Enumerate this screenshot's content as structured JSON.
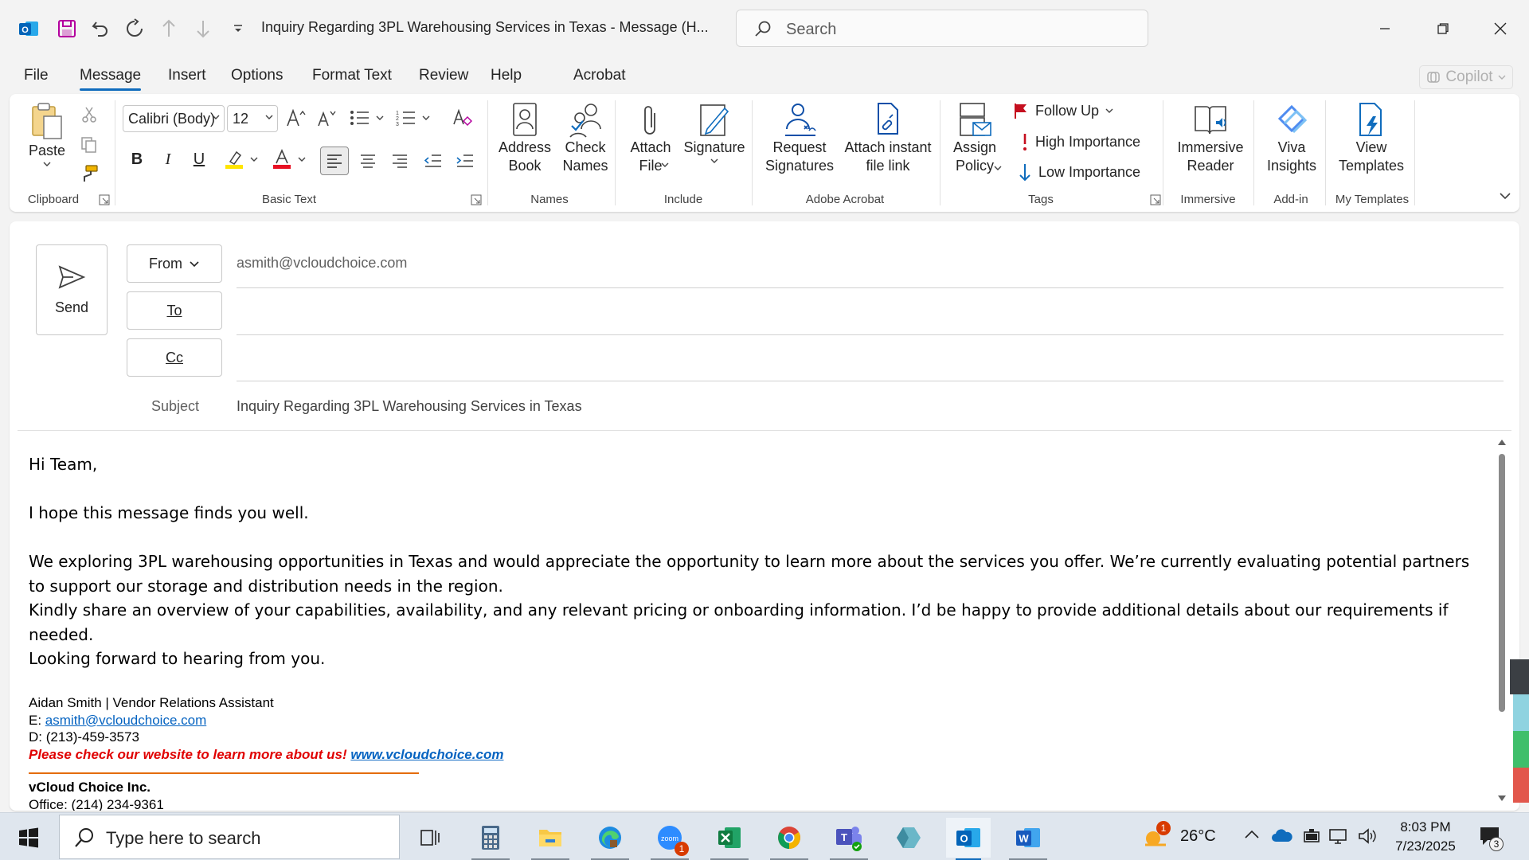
{
  "window": {
    "title": "Inquiry Regarding 3PL Warehousing Services in Texas  -  Message (H...",
    "search_placeholder": "Search"
  },
  "tabs": [
    {
      "label": "File"
    },
    {
      "label": "Message"
    },
    {
      "label": "Insert"
    },
    {
      "label": "Options"
    },
    {
      "label": "Format Text"
    },
    {
      "label": "Review"
    },
    {
      "label": "Help"
    },
    {
      "label": "Acrobat"
    }
  ],
  "active_tab": "Message",
  "copilot_label": "Copilot",
  "ribbon": {
    "clipboard": {
      "group": "Clipboard",
      "paste": "Paste"
    },
    "basic_text": {
      "group": "Basic Text",
      "font": "Calibri (Body)",
      "size": "12"
    },
    "names": {
      "group": "Names",
      "address_book": "Address\nBook",
      "check_names": "Check\nNames"
    },
    "include": {
      "group": "Include",
      "attach_file": "Attach\nFile",
      "signature": "Signature"
    },
    "acrobat": {
      "group": "Adobe Acrobat",
      "request_signatures": "Request\nSignatures",
      "attach_link": "Attach instant\nfile link"
    },
    "tags": {
      "group": "Tags",
      "assign_policy": "Assign\nPolicy",
      "follow_up": "Follow Up",
      "high_importance": "High Importance",
      "low_importance": "Low Importance"
    },
    "immersive": {
      "group": "Immersive",
      "reader": "Immersive\nReader"
    },
    "addin": {
      "group": "Add-in",
      "viva": "Viva\nInsights"
    },
    "templates": {
      "group": "My Templates",
      "view": "View\nTemplates"
    }
  },
  "compose": {
    "send": "Send",
    "from_label": "From",
    "from_value": "asmith@vcloudchoice.com",
    "to_label": "To",
    "cc_label": "Cc",
    "subject_label": "Subject",
    "subject_value": "Inquiry Regarding 3PL Warehousing Services in Texas"
  },
  "body": {
    "greeting": "Hi Team,",
    "line1": "I hope this message finds you well.",
    "para1": "We exploring 3PL warehousing opportunities in Texas and would appreciate the opportunity to learn more about the services you offer. We’re currently evaluating potential partners to support our storage and distribution needs in the region.",
    "para2": "Kindly share an overview of your capabilities, availability, and any relevant pricing or onboarding information. I’d be happy to provide additional details about our requirements if needed.",
    "closing": "Looking forward to hearing from you."
  },
  "signature": {
    "name_line": "Aidan Smith | Vendor Relations Assistant",
    "email_prefix": "E: ",
    "email": "asmith@vcloudchoice.com",
    "direct": "D: (213)-459-3573",
    "promo": "Please check our website to learn more about us!",
    "website": "www.vcloudchoice.com",
    "company": "vCloud Choice Inc.",
    "office": "Office: (214) 234-9361"
  },
  "taskbar": {
    "search_placeholder": "Type here to search",
    "weather": "26°C",
    "weather_badge": "1",
    "zoom_badge": "1",
    "time": "8:03 PM",
    "date": "7/23/2025",
    "notifications": "3"
  },
  "colors": {
    "accent": "#0f6cbd",
    "outlook_blue": "#0364b8",
    "promo_red": "#e00000",
    "link_blue": "#0563c1",
    "rule_orange": "#e46c0a"
  }
}
